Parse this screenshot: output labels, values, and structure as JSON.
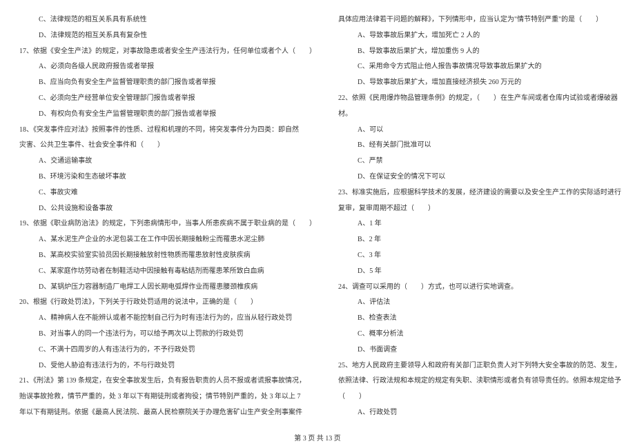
{
  "leftColumn": [
    {
      "text": "C、法律规范的相互关系具有系统性",
      "indent": 2
    },
    {
      "text": "D、法律规范的相互关系具有复杂性",
      "indent": 2
    },
    {
      "text": "17、依据《安全生产法》的规定，对事故隐患或者安全生产违法行为，任何单位或者个人（　　）",
      "indent": 0
    },
    {
      "text": "A、必须向各级人民政府报告或者举报",
      "indent": 2
    },
    {
      "text": "B、应当向负有安全生产监督管理职责的部门报告或者举报",
      "indent": 2
    },
    {
      "text": "C、必须向生产经营单位安全管理部门报告或者举报",
      "indent": 2
    },
    {
      "text": "D、有权向负有安全生产监督管理职责的部门报告或者举报",
      "indent": 2
    },
    {
      "text": "18、《突发事件应对法》按照事件的性质、过程和机理的不同，将突发事件分为四类：即自然",
      "indent": 0
    },
    {
      "text": "灾害、公共卫生事件、社会安全事件和（　　）",
      "indent": 0
    },
    {
      "text": "A、交通运输事故",
      "indent": 2
    },
    {
      "text": "B、环境污染和生态破坏事故",
      "indent": 2
    },
    {
      "text": "C、事故灾难",
      "indent": 2
    },
    {
      "text": "D、公共设施和设备事故",
      "indent": 2
    },
    {
      "text": "19、依据《职业病防治法》的规定，下列患病情形中，当事人所患疾病不属于职业病的是（　　）",
      "indent": 0
    },
    {
      "text": "A、某水泥生产企业的水泥包装工在工作中因长期接触粉尘而罹患水泥尘肺",
      "indent": 2
    },
    {
      "text": "B、某高校实验室实验员因长期接触放射性物质而罹患放射性皮肤疾病",
      "indent": 2
    },
    {
      "text": "C、某家庭作坊劳动者在制鞋活动中因接触有毒粘结剂而罹患苯所致白血病",
      "indent": 2
    },
    {
      "text": "D、某锅炉压力容器制造厂电焊工人因长期电弧焊作业而罹患腰颈椎疾病",
      "indent": 2
    },
    {
      "text": "20、根据《行政处罚法》，下列关于行政处罚适用的说法中，正确的是（　　）",
      "indent": 0
    },
    {
      "text": "A、精神病人在不能辨认或者不能控制自己行为时有违法行为的，应当从轻行政处罚",
      "indent": 2
    },
    {
      "text": "B、对当事人的同一个违法行为，可以给予两次以上罚款的行政处罚",
      "indent": 2
    },
    {
      "text": "C、不满十四周岁的人有违法行为的，不予行政处罚",
      "indent": 2
    },
    {
      "text": "D、受他人胁迫有违法行为的，不与行政处罚",
      "indent": 2
    },
    {
      "text": "21、《刑法》第 139 条规定，在安全事故发生后，负有报告职责的人员不报或者谎报事故情况，",
      "indent": 0
    },
    {
      "text": "贻误事故抢救，情节严重的，处 3 年以下有期徒刑或者拘役；情节特别严重的，处 3 年以上 7",
      "indent": 0
    },
    {
      "text": "年以下有期徒刑。依据《最高人民法院、最高人民检察院关于办理危害矿山生产安全刑事案件",
      "indent": 0
    }
  ],
  "rightColumn": [
    {
      "text": "具体应用法律若干问题的解释》，下列情形中，应当认定为\"情节特别严重\"的是（　　）",
      "indent": 0
    },
    {
      "text": "A、导致事故后果扩大，增加死亡 2 人的",
      "indent": 2
    },
    {
      "text": "B、导致事故后果扩大，增加重伤 9 人的",
      "indent": 2
    },
    {
      "text": "C、采用命令方式阻止他人报告事故情况导致事故后果扩大的",
      "indent": 2
    },
    {
      "text": "D、导致事故后果扩大，增加直接经济损失 260 万元的",
      "indent": 2
    },
    {
      "text": "22、依照《民用爆炸物品管理条例》的规定，（　　）在生产车间或者仓库内试验或者爆破器",
      "indent": 0
    },
    {
      "text": "材。",
      "indent": 0
    },
    {
      "text": "A、可以",
      "indent": 2
    },
    {
      "text": "B、经有关部门批准可以",
      "indent": 2
    },
    {
      "text": "C、严禁",
      "indent": 2
    },
    {
      "text": "D、在保证安全的情况下可以",
      "indent": 2
    },
    {
      "text": "23、标准实施后，应根据科学技术的发展，经济建设的需要以及安全生产工作的实际适时进行",
      "indent": 0
    },
    {
      "text": "复审，复审周期不超过（　　）",
      "indent": 0
    },
    {
      "text": "A、1 年",
      "indent": 2
    },
    {
      "text": "B、2 年",
      "indent": 2
    },
    {
      "text": "C、3 年",
      "indent": 2
    },
    {
      "text": "D、5 年",
      "indent": 2
    },
    {
      "text": "24、调查可以采用的（　　）方式，也可以进行实地调查。",
      "indent": 0
    },
    {
      "text": "A、评估法",
      "indent": 2
    },
    {
      "text": "B、检查表法",
      "indent": 2
    },
    {
      "text": "C、概率分析法",
      "indent": 2
    },
    {
      "text": "D、书面调查",
      "indent": 2
    },
    {
      "text": "25、地方人民政府主要领导人和政府有关部门正职负责人对下列特大安全事故的防范、发生，",
      "indent": 0
    },
    {
      "text": "依照法律、行政法规和本规定的规定有失职、渎职情形或者负有领导责任的。依照本规定给予",
      "indent": 0
    },
    {
      "text": "（　　）",
      "indent": 0
    },
    {
      "text": "A、行政处罚",
      "indent": 2
    }
  ],
  "footer": "第 3 页 共 13 页"
}
